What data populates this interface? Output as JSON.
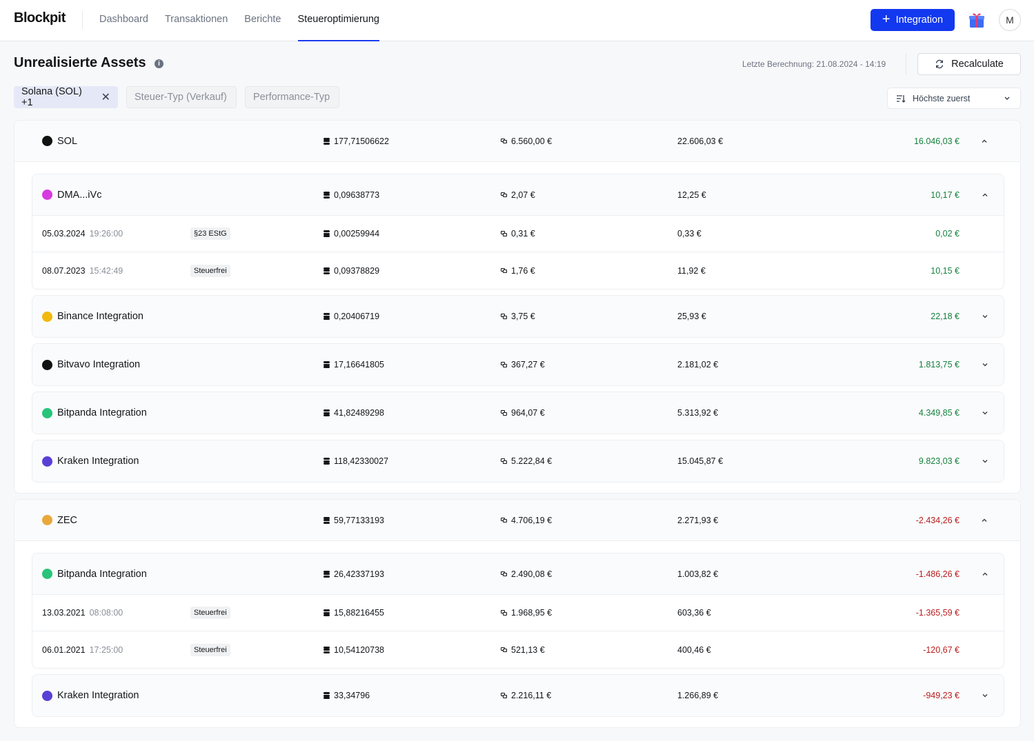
{
  "nav": {
    "logo": "Blockpit",
    "items": [
      "Dashboard",
      "Transaktionen",
      "Berichte",
      "Steueroptimierung"
    ],
    "integration_label": "Integration",
    "avatar_initial": "M"
  },
  "header": {
    "title": "Unrealisierte Assets",
    "last_calc": "Letzte Berechnung: 21.08.2024 - 14:19",
    "recalc_label": "Recalculate"
  },
  "filters": {
    "active_chip": "Solana (SOL) +1",
    "chip_tax_type": "Steuer-Typ (Verkauf)",
    "chip_performance_type": "Performance-Typ",
    "sort_label": "Höchste zuerst"
  },
  "groups": [
    {
      "symbol": "SOL",
      "coin_color": "#111111",
      "qty": "177,71506622",
      "cost": "6.560,00 €",
      "value": "22.606,03 €",
      "gain": "16.046,03 €",
      "subs": [
        {
          "name": "DMA...iVc",
          "coin_color": "#d63ae0",
          "qty": "0,09638773",
          "cost": "2,07 €",
          "value": "12,25 €",
          "gain": "10,17 €",
          "open": true,
          "txs": [
            {
              "date": "05.03.2024",
              "time": "19:26:00",
              "tag": "§23 EStG",
              "qty": "0,00259944",
              "cost": "0,31 €",
              "value": "0,33 €",
              "gain": "0,02 €"
            },
            {
              "date": "08.07.2023",
              "time": "15:42:49",
              "tag": "Steuerfrei",
              "qty": "0,09378829",
              "cost": "1,76 €",
              "value": "11,92 €",
              "gain": "10,15 €"
            }
          ]
        },
        {
          "name": "Binance Integration",
          "coin_color": "#f0b90b",
          "qty": "0,20406719",
          "cost": "3,75 €",
          "value": "25,93 €",
          "gain": "22,18 €"
        },
        {
          "name": "Bitvavo Integration",
          "coin_color": "#111111",
          "qty": "17,16641805",
          "cost": "367,27 €",
          "value": "2.181,02 €",
          "gain": "1.813,75 €"
        },
        {
          "name": "Bitpanda Integration",
          "coin_color": "#27c47a",
          "qty": "41,82489298",
          "cost": "964,07 €",
          "value": "5.313,92 €",
          "gain": "4.349,85 €"
        },
        {
          "name": "Kraken Integration",
          "coin_color": "#5a3fd6",
          "qty": "118,42330027",
          "cost": "5.222,84 €",
          "value": "15.045,87 €",
          "gain": "9.823,03 €"
        }
      ]
    },
    {
      "symbol": "ZEC",
      "coin_color": "#eaa83a",
      "qty": "59,77133193",
      "cost": "4.706,19 €",
      "value": "2.271,93 €",
      "gain": "-2.434,26 €",
      "subs": [
        {
          "name": "Bitpanda Integration",
          "coin_color": "#27c47a",
          "qty": "26,42337193",
          "cost": "2.490,08 €",
          "value": "1.003,82 €",
          "gain": "-1.486,26 €",
          "open": true,
          "txs": [
            {
              "date": "13.03.2021",
              "time": "08:08:00",
              "tag": "Steuerfrei",
              "qty": "15,88216455",
              "cost": "1.968,95 €",
              "value": "603,36 €",
              "gain": "-1.365,59 €"
            },
            {
              "date": "06.01.2021",
              "time": "17:25:00",
              "tag": "Steuerfrei",
              "qty": "10,54120738",
              "cost": "521,13 €",
              "value": "400,46 €",
              "gain": "-120,67 €"
            }
          ]
        },
        {
          "name": "Kraken Integration",
          "coin_color": "#5a3fd6",
          "qty": "33,34796",
          "cost": "2.216,11 €",
          "value": "1.266,89 €",
          "gain": "-949,23 €"
        }
      ]
    }
  ],
  "colors": {
    "accent": "#1238f0",
    "positive": "#15803d",
    "negative": "#b91c1c"
  }
}
